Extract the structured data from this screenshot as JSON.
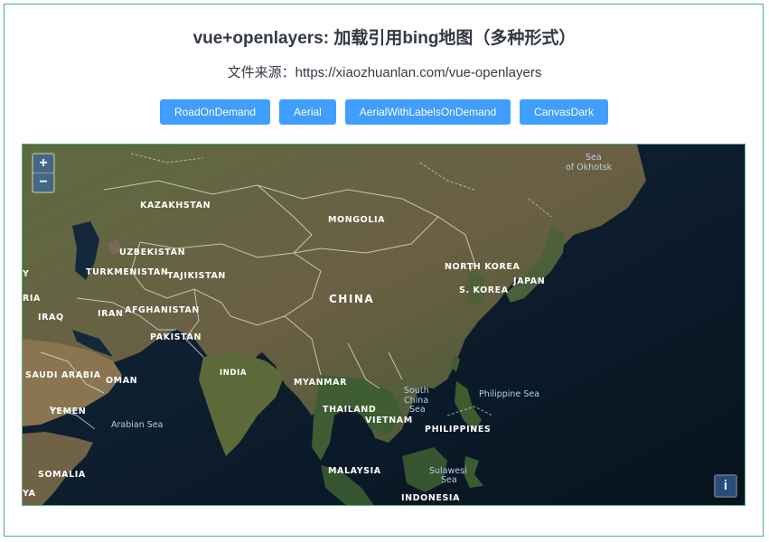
{
  "page": {
    "title": "vue+openlayers: 加载引用bing地图（多种形式）",
    "source": "文件来源：https://xiaozhuanlan.com/vue-openlayers"
  },
  "buttons": [
    {
      "label": "RoadOnDemand"
    },
    {
      "label": "Aerial"
    },
    {
      "label": "AerialWithLabelsOnDemand"
    },
    {
      "label": "CanvasDark"
    }
  ],
  "map": {
    "zoom_in": "+",
    "zoom_out": "−",
    "attribution": "i",
    "labels": {
      "kazakhstan": "KAZAKHSTAN",
      "mongolia": "MONGOLIA",
      "uzbekistan": "UZBEKISTAN",
      "turkmenistan": "TURKMENISTAN",
      "tajikistan": "TAJIKISTAN",
      "north_korea": "NORTH KOREA",
      "japan": "JAPAN",
      "south_korea": "S. KOREA",
      "china": "CHINA",
      "iraq": "IRAQ",
      "iran": "IRAN",
      "afghanistan": "AFGHANISTAN",
      "pakistan": "PAKISTAN",
      "saudi_arabia": "SAUDI ARABIA",
      "oman": "OMAN",
      "india": "INDIA",
      "myanmar": "MYANMAR",
      "yemen": "YEMEN",
      "thailand": "THAILAND",
      "vietnam": "VIETNAM",
      "philippines": "PHILIPPINES",
      "somalia": "SOMALIA",
      "malaysia": "MALAYSIA",
      "indonesia": "INDONESIA",
      "edge_y": "Y",
      "edge_ria": "RIA",
      "edge_ya": "YA",
      "sea_okhotsk_1": "Sea",
      "sea_okhotsk_2": "of Okhotsk",
      "arabian_sea": "Arabian Sea",
      "south_china_sea_1": "South",
      "south_china_sea_2": "China",
      "south_china_sea_3": "Sea",
      "philippine_sea": "Philippine Sea",
      "sulawesi_sea_1": "Sulawesi",
      "sulawesi_sea_2": "Sea"
    }
  }
}
